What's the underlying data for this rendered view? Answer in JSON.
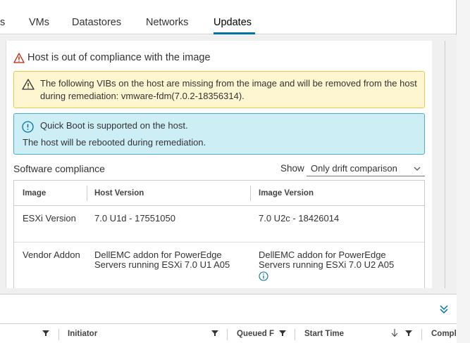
{
  "tabs": [
    {
      "label": "s"
    },
    {
      "label": "VMs"
    },
    {
      "label": "Datastores"
    },
    {
      "label": "Networks"
    },
    {
      "label": "Updates",
      "active": true
    }
  ],
  "compliance": {
    "title": "Host is out of compliance with the image",
    "warning_text": "The following VIBs on the host are missing from the image and will be removed from the host during remediation: vmware-fdm(7.0.2-18356314).",
    "info_line1": "Quick Boot is supported on the host.",
    "info_line2": "The host will be rebooted during remediation."
  },
  "software": {
    "title": "Software compliance",
    "show_label": "Show",
    "show_value": "Only drift comparison",
    "columns": [
      "Image",
      "Host Version",
      "Image Version"
    ],
    "rows": [
      {
        "image": "ESXi Version",
        "host": "7.0 U1d - 17551050",
        "target": "7.0 U2c - 18426014"
      },
      {
        "image": "Vendor Addon",
        "host": "DellEMC addon for PowerEdge Servers running ESXi 7.0 U1 A05",
        "target": "DellEMC addon for PowerEdge Servers running ESXi 7.0 U2 A05"
      }
    ]
  },
  "tasks": {
    "columns": [
      "Initiator",
      "Queued F",
      "Start Time",
      "Compl"
    ]
  },
  "colors": {
    "accent": "#0072a3",
    "warning_bg": "#fef6d0",
    "info_bg": "#cdeef4"
  }
}
